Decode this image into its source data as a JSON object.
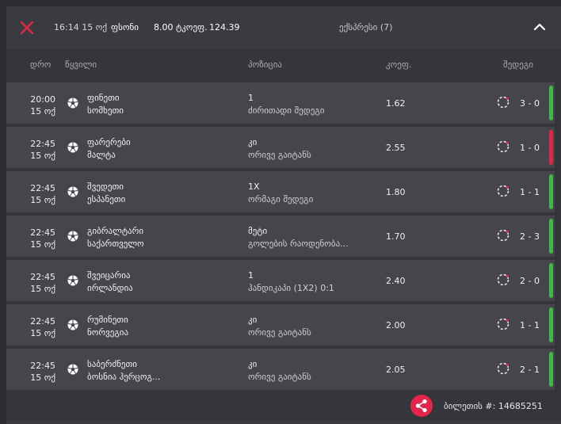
{
  "header": {
    "time": "16:14 15 ოქ",
    "status": "ფსონი",
    "odds_label": "8.00 ტკოეფ.",
    "payout": "124.39",
    "bet_type": "ექსპრესი (7)"
  },
  "columns": {
    "date": "დრო",
    "event": "წყვილი",
    "position": "პოზიცია",
    "odds": "კოეფ.",
    "result": "შედეგი"
  },
  "colors": {
    "win": "#3fb845",
    "loss": "#e3254a",
    "accent": "#e3254a"
  },
  "rows": [
    {
      "time": "20:00",
      "date": "15 ოქ",
      "team1": "ფინეთი",
      "team2": "სომხეთი",
      "pick": "1",
      "market": "ძირითადი შედეგი",
      "odds": "1.62",
      "score": "3 - 0",
      "status": "win"
    },
    {
      "time": "22:45",
      "date": "15 ოქ",
      "team1": "ფარერები",
      "team2": "მალტა",
      "pick": "კი",
      "market": "ორივე გაიტანს",
      "odds": "2.55",
      "score": "1 - 0",
      "status": "loss"
    },
    {
      "time": "22:45",
      "date": "15 ოქ",
      "team1": "შვედეთი",
      "team2": "ესპანეთი",
      "pick": "1X",
      "market": "ორმაგი შედეგი",
      "odds": "1.80",
      "score": "1 - 1",
      "status": "win"
    },
    {
      "time": "22:45",
      "date": "15 ოქ",
      "team1": "გიბრალტარი",
      "team2": "საქართველო",
      "pick": "მეტი",
      "market": "გოლების რაოდენობა...",
      "odds": "1.70",
      "score": "2 - 3",
      "status": "win"
    },
    {
      "time": "22:45",
      "date": "15 ოქ",
      "team1": "შვეიცარია",
      "team2": "ირლანდია",
      "pick": "1",
      "market": "ჰანდიკაპი (1X2) 0:1",
      "odds": "2.40",
      "score": "2 - 0",
      "status": "win"
    },
    {
      "time": "22:45",
      "date": "15 ოქ",
      "team1": "რუმინეთი",
      "team2": "ნორვეგია",
      "pick": "კი",
      "market": "ორივე გაიტანს",
      "odds": "2.00",
      "score": "1 - 1",
      "status": "win"
    },
    {
      "time": "22:45",
      "date": "15 ოქ",
      "team1": "საბერძნეთი",
      "team2": "ბოსნია ჰერცოგ...",
      "pick": "კი",
      "market": "ორივე გაიტანს",
      "odds": "2.05",
      "score": "2 - 1",
      "status": "win"
    }
  ],
  "footer": {
    "ticket_label": "ბილეთის #: 14685251"
  }
}
